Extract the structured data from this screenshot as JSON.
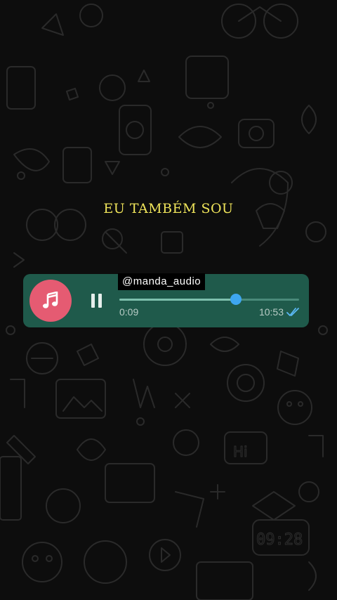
{
  "caption": "EU TAMBÉM SOU",
  "username_tag": "@manda_audio",
  "audio_message": {
    "icon": "music-note-icon",
    "control_icon": "pause-icon",
    "elapsed": "0:09",
    "timestamp": "10:53",
    "status_icon": "double-check-read-icon",
    "progress": 0.65
  },
  "colors": {
    "background": "#0d0d0d",
    "bubble": "#1f5a4b",
    "music_circle": "#e55b72",
    "thumb": "#3ea6f0",
    "caption": "#efe45a",
    "read_ticks": "#5bb8f5"
  }
}
